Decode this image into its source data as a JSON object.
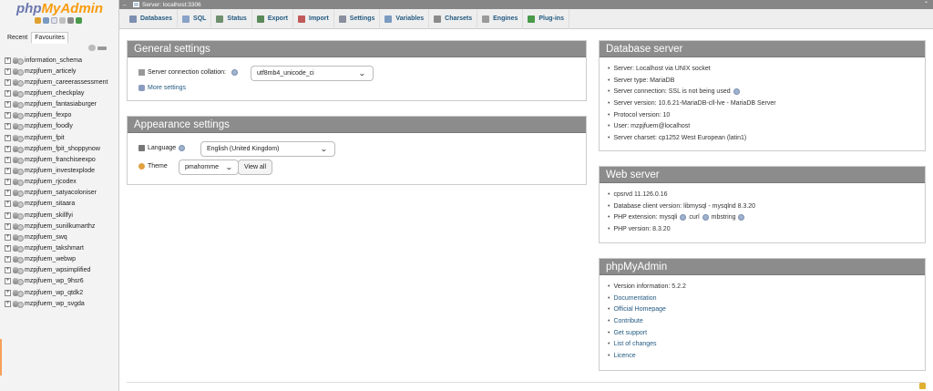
{
  "logo": {
    "php": "php",
    "rest": "MyAdmin"
  },
  "nav": {
    "tabs": [
      "Recent",
      "Favourites"
    ],
    "databases": [
      "information_schema",
      "mzpjfuem_articely",
      "mzpjfuem_careerassessment",
      "mzpjfuem_checkplay",
      "mzpjfuem_fantasiaburger",
      "mzpjfuem_fexpo",
      "mzpjfuem_foodly",
      "mzpjfuem_fpit",
      "mzpjfuem_fpit_shoppynow",
      "mzpjfuem_franchiseexpo",
      "mzpjfuem_investexplode",
      "mzpjfuem_rjcodex",
      "mzpjfuem_satyacoloniser",
      "mzpjfuem_sitaara",
      "mzpjfuem_skillfyi",
      "mzpjfuem_sunilkumarthz",
      "mzpjfuem_swq",
      "mzpjfuem_takshmart",
      "mzpjfuem_webwp",
      "mzpjfuem_wpsimplified",
      "mzpjfuem_wp_9hsr6",
      "mzpjfuem_wp_qtdk2",
      "mzpjfuem_wp_svgda"
    ],
    "expander": "+"
  },
  "serverbar": {
    "title": "Server: localhost:3306",
    "back": "←",
    "caret": "⌃"
  },
  "menu": [
    {
      "label": "Databases",
      "icon": "databases-icon",
      "color": "#7c8fb0"
    },
    {
      "label": "SQL",
      "icon": "sql-icon",
      "color": "#8aa2c8"
    },
    {
      "label": "Status",
      "icon": "status-icon",
      "color": "#6f8f6f"
    },
    {
      "label": "Export",
      "icon": "export-icon",
      "color": "#5a8a5a"
    },
    {
      "label": "Import",
      "icon": "import-icon",
      "color": "#c05a5a"
    },
    {
      "label": "Settings",
      "icon": "settings-icon",
      "color": "#8a8fa0"
    },
    {
      "label": "Variables",
      "icon": "variables-icon",
      "color": "#7a9ac0"
    },
    {
      "label": "Charsets",
      "icon": "charsets-icon",
      "color": "#8a8a8a"
    },
    {
      "label": "Engines",
      "icon": "engines-icon",
      "color": "#9a9a9a"
    },
    {
      "label": "Plug-ins",
      "icon": "plugins-icon",
      "color": "#4a9a4a"
    }
  ],
  "general": {
    "title": "General settings",
    "collation_label": "Server connection collation:",
    "collation_value": "utf8mb4_unicode_ci",
    "more_settings": "More settings"
  },
  "appearance": {
    "title": "Appearance settings",
    "language_label": "Language",
    "language_value": "English (United Kingdom)",
    "theme_label": "Theme",
    "theme_value": "pmahomme",
    "view_all": "View all"
  },
  "db_server": {
    "title": "Database server",
    "items": [
      "Server: Localhost via UNIX socket",
      "Server type: MariaDB",
      "Server connection: SSL is not being used",
      "Server version: 10.6.21-MariaDB-cll-lve - MariaDB Server",
      "Protocol version: 10",
      "User: mzpjfuem@localhost",
      "Server charset: cp1252 West European (latin1)"
    ]
  },
  "web_server": {
    "title": "Web server",
    "items": [
      "cpsrvd 11.126.0.16",
      "Database client version: libmysql - mysqlnd 8.3.20",
      "PHP extension: mysqli",
      "PHP version: 8.3.20"
    ],
    "ext_curl": "curl",
    "ext_mbstring": "mbstring"
  },
  "pma": {
    "title": "phpMyAdmin",
    "version": "Version information: 5.2.2",
    "links": [
      "Documentation",
      "Official Homepage",
      "Contribute",
      "Get support",
      "List of changes",
      "Licence"
    ]
  },
  "colors": {
    "accent": "#235a81",
    "panel_head": "#8c8c8c",
    "logo_php": "#6c78af",
    "logo_rest": "#f89c0e"
  }
}
